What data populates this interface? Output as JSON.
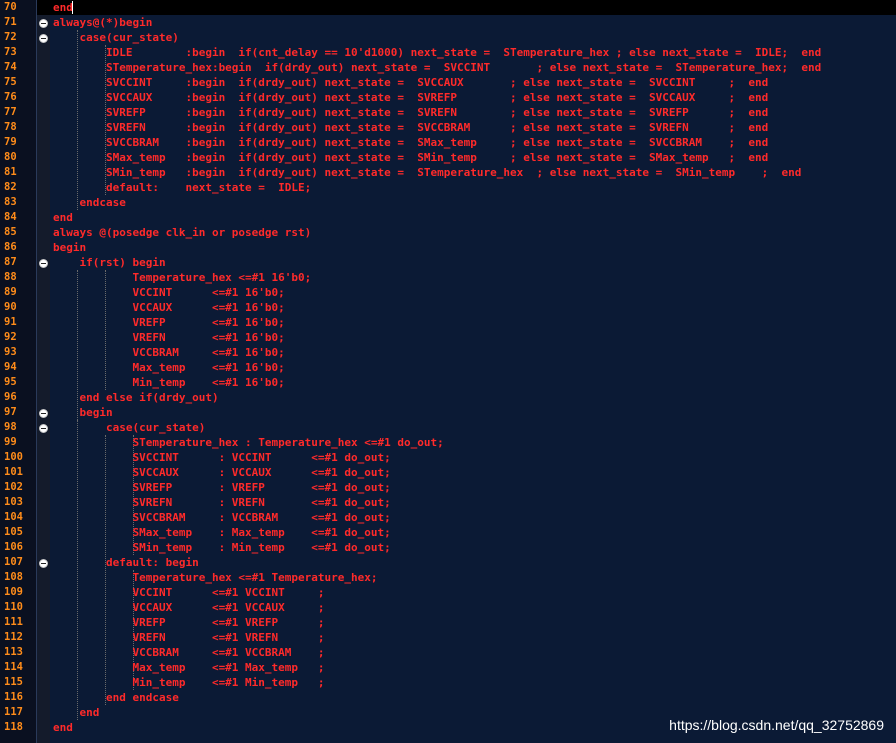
{
  "editor": {
    "lines": [
      {
        "n": "70",
        "text": "end"
      },
      {
        "n": "71",
        "text": "always@(*)begin",
        "fold": true
      },
      {
        "n": "72",
        "text": "    case(cur_state)",
        "fold": true
      },
      {
        "n": "73",
        "text": "        IDLE        :begin  if(cnt_delay == 10'd1000) next_state =  STemperature_hex ; else next_state =  IDLE;  end"
      },
      {
        "n": "74",
        "text": "        STemperature_hex:begin  if(drdy_out) next_state =  SVCCINT       ; else next_state =  STemperature_hex;  end"
      },
      {
        "n": "75",
        "text": "        SVCCINT     :begin  if(drdy_out) next_state =  SVCCAUX       ; else next_state =  SVCCINT     ;  end"
      },
      {
        "n": "76",
        "text": "        SVCCAUX     :begin  if(drdy_out) next_state =  SVREFP        ; else next_state =  SVCCAUX     ;  end"
      },
      {
        "n": "77",
        "text": "        SVREFP      :begin  if(drdy_out) next_state =  SVREFN        ; else next_state =  SVREFP      ;  end"
      },
      {
        "n": "78",
        "text": "        SVREFN      :begin  if(drdy_out) next_state =  SVCCBRAM      ; else next_state =  SVREFN      ;  end"
      },
      {
        "n": "79",
        "text": "        SVCCBRAM    :begin  if(drdy_out) next_state =  SMax_temp     ; else next_state =  SVCCBRAM    ;  end"
      },
      {
        "n": "80",
        "text": "        SMax_temp   :begin  if(drdy_out) next_state =  SMin_temp     ; else next_state =  SMax_temp   ;  end"
      },
      {
        "n": "81",
        "text": "        SMin_temp   :begin  if(drdy_out) next_state =  STemperature_hex  ; else next_state =  SMin_temp    ;  end"
      },
      {
        "n": "82",
        "text": "        default:    next_state =  IDLE;"
      },
      {
        "n": "83",
        "text": "    endcase"
      },
      {
        "n": "84",
        "text": "end"
      },
      {
        "n": "85",
        "text": "always @(posedge clk_in or posedge rst)"
      },
      {
        "n": "86",
        "text": "begin"
      },
      {
        "n": "87",
        "text": "    if(rst) begin",
        "fold": true
      },
      {
        "n": "88",
        "text": "            Temperature_hex <=#1 16'b0;"
      },
      {
        "n": "89",
        "text": "            VCCINT      <=#1 16'b0;"
      },
      {
        "n": "90",
        "text": "            VCCAUX      <=#1 16'b0;"
      },
      {
        "n": "91",
        "text": "            VREFP       <=#1 16'b0;"
      },
      {
        "n": "92",
        "text": "            VREFN       <=#1 16'b0;"
      },
      {
        "n": "93",
        "text": "            VCCBRAM     <=#1 16'b0;"
      },
      {
        "n": "94",
        "text": "            Max_temp    <=#1 16'b0;"
      },
      {
        "n": "95",
        "text": "            Min_temp    <=#1 16'b0;"
      },
      {
        "n": "96",
        "text": "    end else if(drdy_out)"
      },
      {
        "n": "97",
        "text": "    begin",
        "fold": true
      },
      {
        "n": "98",
        "text": "        case(cur_state)",
        "fold": true
      },
      {
        "n": "99",
        "text": "            STemperature_hex : Temperature_hex <=#1 do_out;"
      },
      {
        "n": "100",
        "text": "            SVCCINT      : VCCINT      <=#1 do_out;"
      },
      {
        "n": "101",
        "text": "            SVCCAUX      : VCCAUX      <=#1 do_out;"
      },
      {
        "n": "102",
        "text": "            SVREFP       : VREFP       <=#1 do_out;"
      },
      {
        "n": "103",
        "text": "            SVREFN       : VREFN       <=#1 do_out;"
      },
      {
        "n": "104",
        "text": "            SVCCBRAM     : VCCBRAM     <=#1 do_out;"
      },
      {
        "n": "105",
        "text": "            SMax_temp    : Max_temp    <=#1 do_out;"
      },
      {
        "n": "106",
        "text": "            SMin_temp    : Min_temp    <=#1 do_out;"
      },
      {
        "n": "107",
        "text": "        default: begin",
        "fold": true
      },
      {
        "n": "108",
        "text": "            Temperature_hex <=#1 Temperature_hex;"
      },
      {
        "n": "109",
        "text": "            VCCINT      <=#1 VCCINT     ;"
      },
      {
        "n": "110",
        "text": "            VCCAUX      <=#1 VCCAUX     ;"
      },
      {
        "n": "111",
        "text": "            VREFP       <=#1 VREFP      ;"
      },
      {
        "n": "112",
        "text": "            VREFN       <=#1 VREFN      ;"
      },
      {
        "n": "113",
        "text": "            VCCBRAM     <=#1 VCCBRAM    ;"
      },
      {
        "n": "114",
        "text": "            Max_temp    <=#1 Max_temp   ;"
      },
      {
        "n": "115",
        "text": "            Min_temp    <=#1 Min_temp   ;"
      },
      {
        "n": "116",
        "text": "        end endcase"
      },
      {
        "n": "117",
        "text": "    end"
      },
      {
        "n": "118",
        "text": "end"
      }
    ]
  },
  "watermark": "https://blog.csdn.net/qq_32752869",
  "colors": {
    "background": "#0b1a35",
    "code_text": "#ff2a2a",
    "line_number": "#ff8c1a"
  }
}
